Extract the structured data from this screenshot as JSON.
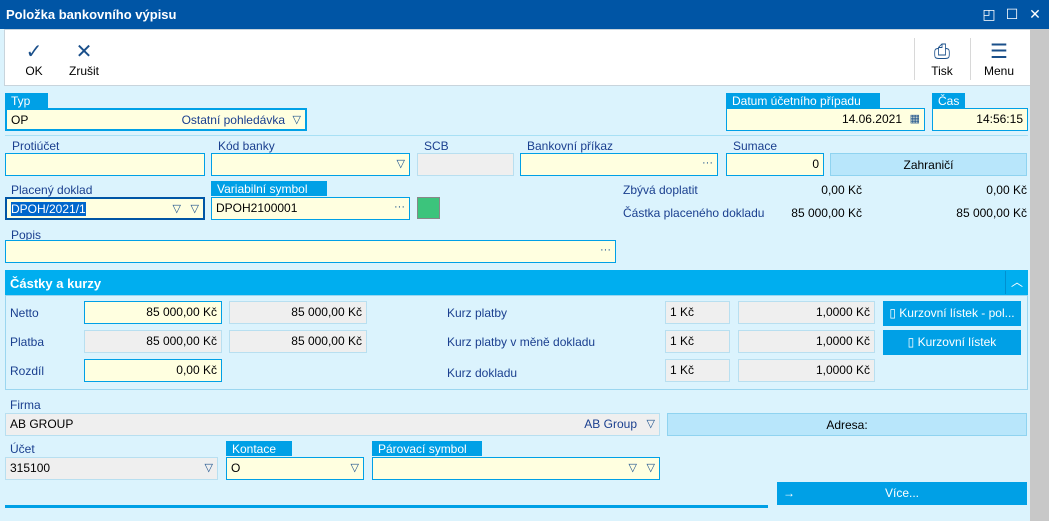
{
  "window": {
    "title": "Položka bankovního výpisu"
  },
  "toolbar": {
    "ok": "OK",
    "cancel": "Zrušit",
    "print": "Tisk",
    "menu": "Menu"
  },
  "typ": {
    "label": "Typ",
    "code": "OP",
    "name": "Ostatní pohledávka"
  },
  "datum": {
    "label": "Datum účetního případu",
    "value": "14.06.2021"
  },
  "cas": {
    "label": "Čas",
    "value": "14:56:15"
  },
  "protiucet": {
    "label": "Protiúčet",
    "value": ""
  },
  "kod_banky": {
    "label": "Kód banky",
    "value": ""
  },
  "scb": {
    "label": "SCB",
    "value": ""
  },
  "bankovni_prikaz": {
    "label": "Bankovní příkaz",
    "value": ""
  },
  "sumace": {
    "label": "Sumace",
    "value": "0"
  },
  "zahranici": {
    "label": "Zahraničí"
  },
  "placeny_doklad": {
    "label": "Placený doklad",
    "value": "DPOH/2021/1"
  },
  "variabilni_symbol": {
    "label": "Variabilní symbol",
    "value": "DPOH2100001"
  },
  "status_color": "#3cc47c",
  "zbyva": {
    "label": "Zbývá doplatit",
    "value1": "0,00 Kč",
    "value2": "0,00 Kč"
  },
  "castka": {
    "label": "Částka placeného dokladu",
    "value1": "85 000,00 Kč",
    "value2": "85 000,00 Kč"
  },
  "popis": {
    "label": "Popis",
    "value": ""
  },
  "section": {
    "title": "Částky a kurzy"
  },
  "amounts": [
    {
      "label": "Netto",
      "v1": "85 000,00 Kč",
      "v2": "85 000,00 Kč"
    },
    {
      "label": "Platba",
      "v1": "85 000,00 Kč",
      "v2": "85 000,00 Kč"
    },
    {
      "label": "Rozdíl",
      "v1": "0,00 Kč"
    }
  ],
  "rates": [
    {
      "label": "Kurz platby",
      "unit": "1 Kč",
      "value": "1,0000 Kč"
    },
    {
      "label": "Kurz platby v měně dokladu",
      "unit": "1 Kč",
      "value": "1,0000 Kč"
    },
    {
      "label": "Kurz dokladu",
      "unit": "1 Kč",
      "value": "1,0000 Kč"
    }
  ],
  "rate_buttons": [
    "Kurzovní lístek - pol...",
    "Kurzovní lístek"
  ],
  "firma": {
    "label": "Firma",
    "code": "AB GROUP",
    "name": "AB Group"
  },
  "adresa": {
    "label": "Adresa:"
  },
  "ucet": {
    "label": "Účet",
    "value": "315100"
  },
  "kontace": {
    "label": "Kontace",
    "value": "O"
  },
  "parovaci": {
    "label": "Párovací symbol",
    "value": ""
  },
  "vice": {
    "label": "Více..."
  }
}
